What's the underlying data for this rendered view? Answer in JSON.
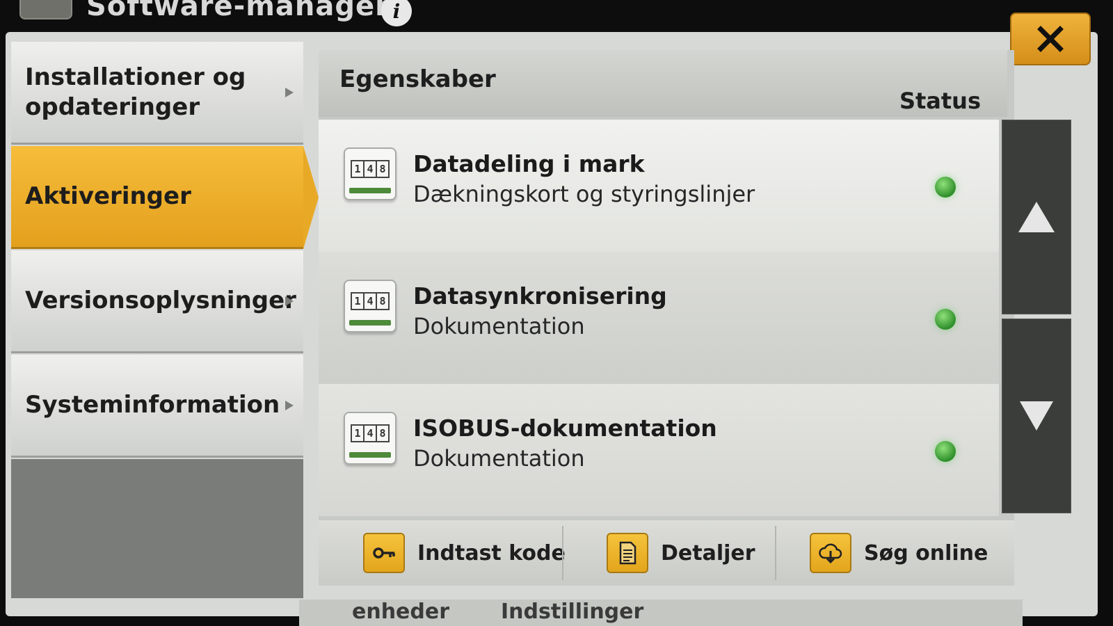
{
  "window": {
    "title": "Software-manager",
    "info_icon": "i"
  },
  "sidebar": {
    "items": [
      {
        "label": "Installationer og opdateringer",
        "has_arrow": true,
        "active": false
      },
      {
        "label": "Aktiveringer",
        "has_arrow": false,
        "active": true
      },
      {
        "label": "Versionsoplysninger",
        "has_arrow": true,
        "active": false
      },
      {
        "label": "Systeminformation",
        "has_arrow": true,
        "active": false
      }
    ]
  },
  "list_header": {
    "properties": "Egenskaber",
    "status": "Status"
  },
  "features": [
    {
      "title": "Datadeling i mark",
      "subtitle": "Dækningskort og styringslinjer",
      "icon": "activation-counter-icon",
      "status": "active"
    },
    {
      "title": "Datasynkronisering",
      "subtitle": "Dokumentation",
      "icon": "activation-counter-icon",
      "status": "active"
    },
    {
      "title": "ISOBUS-dokumentation",
      "subtitle": "Dokumentation",
      "icon": "activation-counter-icon",
      "status": "active"
    }
  ],
  "icon_digits": [
    "1",
    "4",
    "8"
  ],
  "toolbar": {
    "enter_code": "Indtast kode",
    "details": "Detaljer",
    "search_online": "Søg online"
  },
  "bottom_tabs": [
    "enheder",
    "Indstillinger"
  ],
  "colors": {
    "accent": "#E8A927",
    "status_green": "#3FA83A",
    "panel": "#C7C9C6"
  }
}
